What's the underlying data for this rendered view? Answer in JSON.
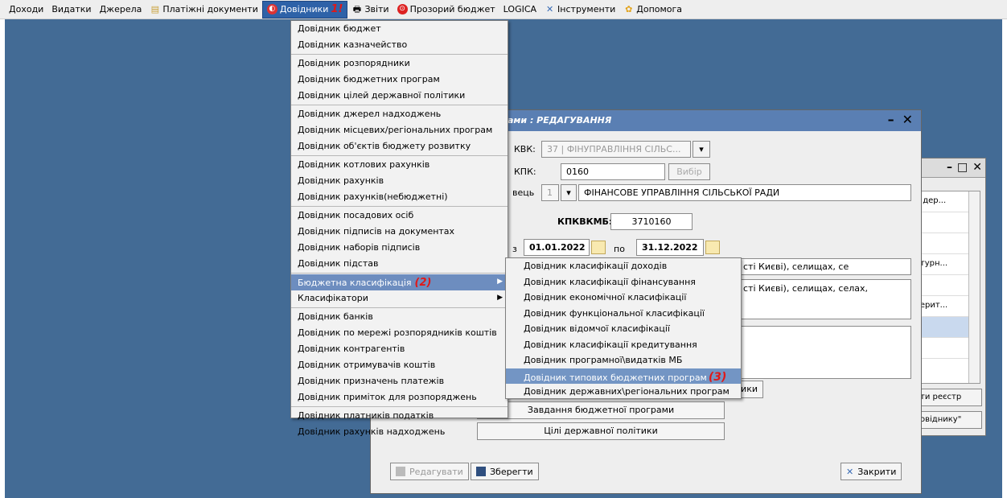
{
  "menubar": {
    "items": [
      {
        "label": "Доходи"
      },
      {
        "label": "Видатки"
      },
      {
        "label": "Джерела"
      },
      {
        "label": "Платіжні документи",
        "icon": "documents-icon"
      },
      {
        "label": "Довідники",
        "icon": "directory-icon",
        "annotation": "1!"
      },
      {
        "label": "Звіти",
        "icon": "printer-icon"
      },
      {
        "label": "Прозорий бюджет",
        "icon": "transparent-budget-icon"
      },
      {
        "label": "LOGICA"
      },
      {
        "label": "Інструменти",
        "icon": "tools-icon"
      },
      {
        "label": "Допомога",
        "icon": "help-icon"
      }
    ]
  },
  "menu": {
    "items": [
      "Довідник бюджет",
      "Довідник казначейство",
      "Довідник розпорядники",
      "Довідник бюджетних програм",
      "Довідник цілей державної політики",
      "Довідник джерел надходжень",
      "Довідник місцевих/регіональних програм",
      "Довідник об'єктів бюджету розвитку",
      "Довідник котлових рахунків",
      "Довідник рахунків",
      "Довідник рахунків(небюджетні)",
      "Довідник посадових осіб",
      "Довідник підписів на документах",
      "Довідник наборів підписів",
      "Довідник підстав",
      "Бюджетна класифікація",
      "Класифікатори",
      "Довідник банків",
      "Довідник по мережі розпорядників коштів",
      "Довідник контрагентів",
      "Довідник отримувачів коштів",
      "Довідник призначень платежів",
      "Довідник приміток для розпоряджень",
      "Довідник платників податків",
      "Довідник рахунків надходжень"
    ],
    "annotation_2": "(2)"
  },
  "submenu": {
    "items": [
      "Довідник класифікації доходів",
      "Довідник класифікації фінансування",
      "Довідник економічної класифікації",
      "Довідник функціональної класифікації",
      "Довідник відомчої класифікації",
      "Довідник класифікації кредитування",
      "Довідник програмної\\видатків МБ",
      "Довідник типових бюджетних програм",
      "Довідник державних\\регіональних програм"
    ],
    "annotation_3": "(3)"
  },
  "main_window": {
    "title": "ами : РЕДАГУВАННЯ",
    "kvk_label": "КВК:",
    "kvk_value": "37 | ФІНУПРАВЛІННЯ СІЛЬС...",
    "kpk_label": "КПК:",
    "kpk_value": "0160",
    "choose_label": "Вибір",
    "executor_label": "вець",
    "executor_num": "1",
    "executor_name": "ФІНАНСОВЕ УПРАВЛІННЯ СІЛЬСЬКОЇ РАДИ",
    "kpkvkmb_label": "КПКВКМБ:",
    "kpkvkmb_value": "3710160",
    "from_label": "з",
    "date_from": "01.01.2022",
    "to_label": "по",
    "date_to": "31.12.2022",
    "text1": "сті Києві), селищах, се",
    "text2": "сті Києві), селищах, селах,",
    "btn_partial": "ники",
    "btn_tasks": "Завдання бюджетної програми",
    "btn_goals": "Цілі державної політики",
    "btn_edit": "Редагувати",
    "btn_save": "Зберегти",
    "btn_close": "Закрити"
  },
  "bg_window": {
    "rows": [
      "я дер...",
      "",
      "",
      "ьтурн...",
      "",
      "терит...",
      "",
      ""
    ],
    "btn1": "ти реєстр",
    "btn2": "овіднику\""
  }
}
